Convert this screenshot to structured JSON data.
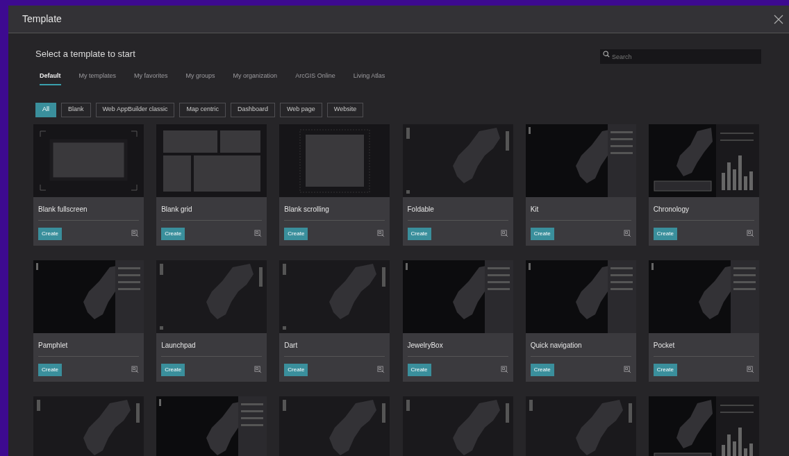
{
  "dialog": {
    "title": "Template"
  },
  "heading": "Select a template to start",
  "search": {
    "placeholder": "Search"
  },
  "tabs": [
    {
      "label": "Default",
      "selected": true
    },
    {
      "label": "My templates",
      "selected": false
    },
    {
      "label": "My favorites",
      "selected": false
    },
    {
      "label": "My groups",
      "selected": false
    },
    {
      "label": "My organization",
      "selected": false
    },
    {
      "label": "ArcGIS Online",
      "selected": false
    },
    {
      "label": "Living Atlas",
      "selected": false
    }
  ],
  "filters": [
    {
      "label": "All",
      "selected": true
    },
    {
      "label": "Blank",
      "selected": false
    },
    {
      "label": "Web AppBuilder classic",
      "selected": false
    },
    {
      "label": "Map centric",
      "selected": false
    },
    {
      "label": "Dashboard",
      "selected": false
    },
    {
      "label": "Web page",
      "selected": false
    },
    {
      "label": "Website",
      "selected": false
    }
  ],
  "templates": [
    {
      "name": "Blank fullscreen",
      "button": "Create",
      "kind": "fullscreen"
    },
    {
      "name": "Blank grid",
      "button": "Create",
      "kind": "grid"
    },
    {
      "name": "Blank scrolling",
      "button": "Create",
      "kind": "scrolling"
    },
    {
      "name": "Foldable",
      "button": "Create",
      "kind": "map"
    },
    {
      "name": "Kit",
      "button": "Create",
      "kind": "mappanel"
    },
    {
      "name": "Chronology",
      "button": "Create",
      "kind": "mapchart"
    },
    {
      "name": "Pamphlet",
      "button": "Create",
      "kind": "mappanel"
    },
    {
      "name": "Launchpad",
      "button": "Create",
      "kind": "map"
    },
    {
      "name": "Dart",
      "button": "Create",
      "kind": "map"
    },
    {
      "name": "JewelryBox",
      "button": "Create",
      "kind": "mappanel"
    },
    {
      "name": "Quick navigation",
      "button": "Create",
      "kind": "mappanel"
    },
    {
      "name": "Pocket",
      "button": "Create",
      "kind": "mappanel"
    }
  ],
  "more_previews": [
    {
      "kind": "map"
    },
    {
      "kind": "mappanel"
    },
    {
      "kind": "map"
    },
    {
      "kind": "map"
    },
    {
      "kind": "map"
    },
    {
      "kind": "mapchart"
    }
  ]
}
